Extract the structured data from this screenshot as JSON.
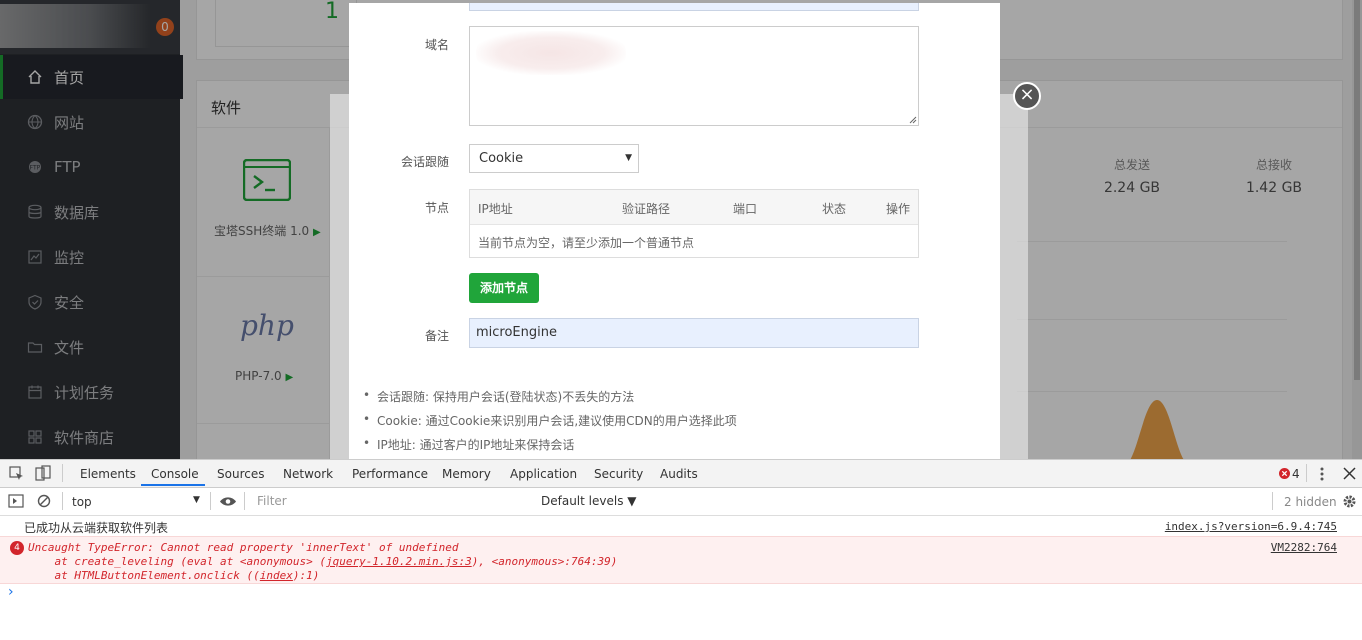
{
  "sidebar": {
    "badge": "0",
    "items": [
      {
        "label": "首页",
        "icon": "home-icon"
      },
      {
        "label": "网站",
        "icon": "globe-icon"
      },
      {
        "label": "FTP",
        "icon": "ftp-icon"
      },
      {
        "label": "数据库",
        "icon": "database-icon"
      },
      {
        "label": "监控",
        "icon": "monitor-icon"
      },
      {
        "label": "安全",
        "icon": "shield-icon"
      },
      {
        "label": "文件",
        "icon": "folder-icon"
      },
      {
        "label": "计划任务",
        "icon": "calendar-icon"
      },
      {
        "label": "软件商店",
        "icon": "grid-icon"
      }
    ]
  },
  "main": {
    "top_count": "1",
    "software_title": "软件",
    "apps": [
      {
        "label": "宝塔SSH终端 1.0",
        "icon": "terminal-icon"
      },
      {
        "label": "PHP-7.0",
        "icon": "php-logo"
      }
    ],
    "play_glyph": "▶",
    "php_logo_text": "php",
    "stats": [
      {
        "label": "总发送",
        "value": "2.24 GB"
      },
      {
        "label": "总接收",
        "value": "1.42 GB"
      }
    ]
  },
  "modal": {
    "domain_label": "域名",
    "session_label": "会话跟随",
    "session_value": "Cookie",
    "node_label": "节点",
    "table_headers": [
      "IP地址",
      "验证路径",
      "端口",
      "状态",
      "操作"
    ],
    "empty_text": "当前节点为空，请至少添加一个普通节点",
    "add_node_label": "添加节点",
    "remark_label": "备注",
    "remark_value": "microEngine",
    "tips": [
      "会话跟随: 保持用户会话(登陆状态)不丢失的方法",
      "Cookie: 通过Cookie来识别用户会话,建议使用CDN的用户选择此项",
      "IP地址: 通过客户的IP地址来保持会话"
    ]
  },
  "devtools": {
    "tabs": [
      "Elements",
      "Console",
      "Sources",
      "Network",
      "Performance",
      "Memory",
      "Application",
      "Security",
      "Audits"
    ],
    "error_badge": "4",
    "context": "top",
    "filter_placeholder": "Filter",
    "levels": "Default levels ▼",
    "hidden": "2 hidden",
    "log1_text": "已成功从云端获取软件列表",
    "log1_source": "index.js?version=6.9.4:745",
    "log2_count": "4",
    "log2_line1": "Uncaught TypeError: Cannot read property 'innerText' of undefined",
    "log2_line2_prefix": "    at create_leveling (eval at <anonymous> (",
    "log2_line2_link": "jquery-1.10.2.min.js:3",
    "log2_line2_suffix": "), <anonymous>:764:39)",
    "log2_line3_prefix": "    at HTMLButtonElement.onclick ((",
    "log2_line3_link": "index",
    "log2_line3_suffix": "):1)",
    "log2_source": "VM2282:764",
    "prompt": "›"
  },
  "colors": {
    "accent_green": "#20a53a",
    "sidebar_bg": "#2f3237",
    "error_red": "#d2252b"
  }
}
